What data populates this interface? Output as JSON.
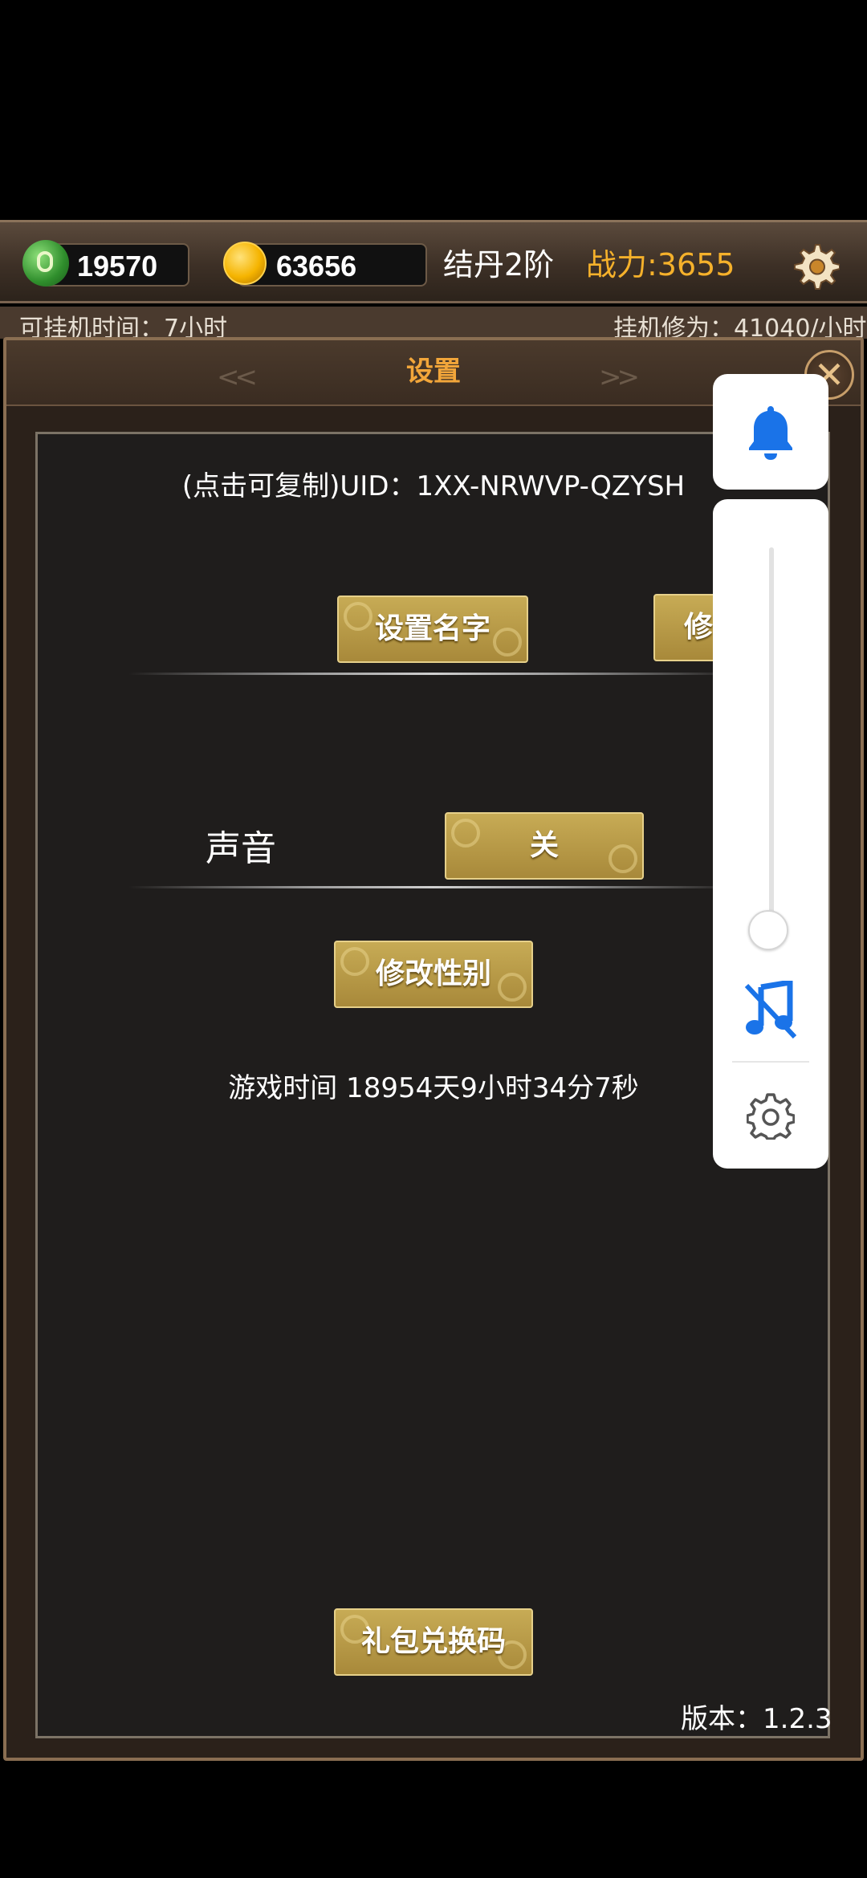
{
  "topbar": {
    "jade_amount": "19570",
    "gold_amount": "63656",
    "realm": "结丹2阶",
    "power": "战力:3655"
  },
  "infostrip": {
    "left_text": "可挂机时间：7小时",
    "right_text": "挂机修为：41040/小时"
  },
  "dialog": {
    "title": "设置",
    "deco_left": "<<",
    "deco_right": ">>",
    "close_label": "✕",
    "uid": "(点击可复制)UID：1XX-NRWVP-QZYSH",
    "set_name_button": "设置名字",
    "partial_button": "修",
    "sound_label": "声音",
    "sound_toggle": "关",
    "change_gender_button": "修改性别",
    "play_time": "游戏时间 18954天9小时34分7秒",
    "gift_code_button": "礼包兑换码",
    "version": "版本：1.2.3"
  },
  "volume_panel": {
    "level": 0.0,
    "icons": [
      "bell-icon",
      "music-off-icon",
      "settings-gear-icon"
    ]
  },
  "colors": {
    "accent_gold": "#f5b12b",
    "title_orange": "#f2a63a",
    "system_blue": "#1a73e8"
  }
}
